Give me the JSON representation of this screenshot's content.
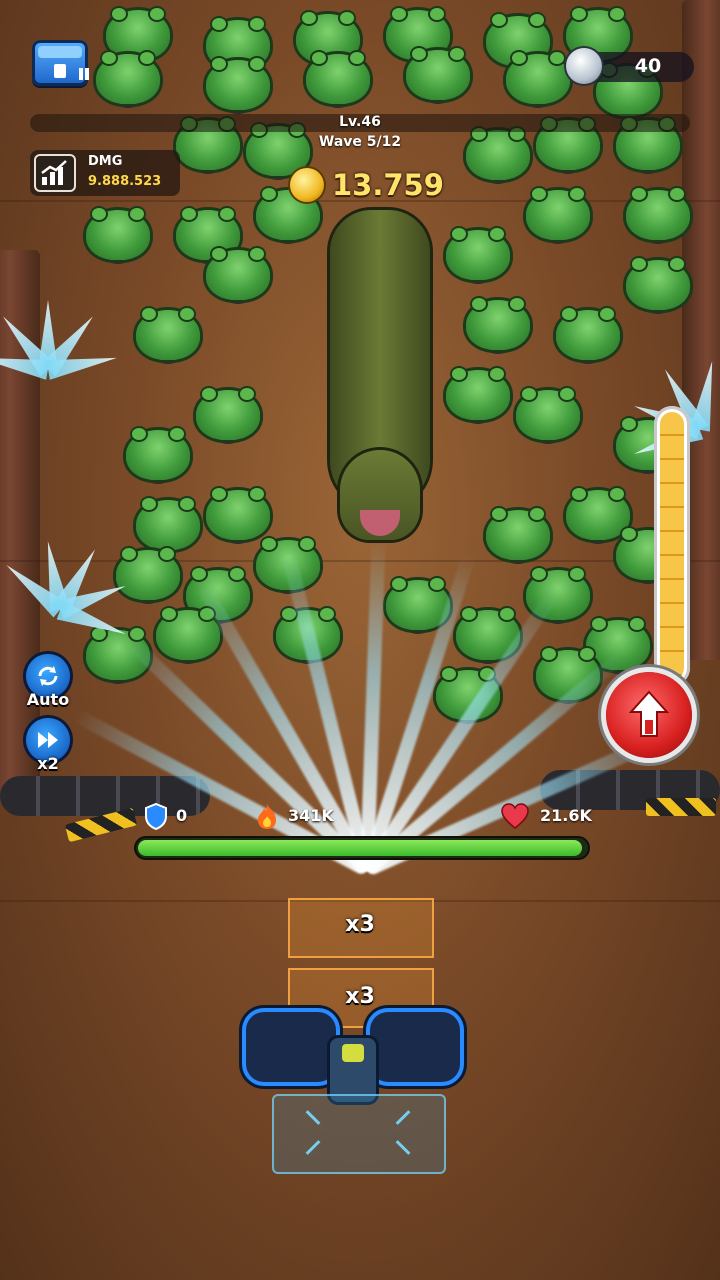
{
  "hud": {
    "gems": "40",
    "level": "Lv.46",
    "wave": "Wave 5/12",
    "dmg_label": "DMG",
    "dmg_value": "9.888.523",
    "coins": "13.759"
  },
  "side_buttons": {
    "auto_label": "Auto",
    "speed_label": "x2"
  },
  "base_stats": {
    "shield": "0",
    "fire": "341K",
    "hp": "21.6K",
    "hp_fraction": 0.99
  },
  "power_meter_fraction": 1.0,
  "turret": {
    "multiplier_top": "x3",
    "multiplier_bottom": "x3"
  },
  "colors": {
    "coin_text": "#ffe36a",
    "dmg_value": "#ffd84a",
    "hp_fill": "#3cba2a",
    "rocket_button": "#d82020",
    "meter_fill": "#f7c648"
  },
  "icons": [
    "chest-icon",
    "pause-icon",
    "gem-icon",
    "chart-icon",
    "coin-icon",
    "auto-cycle-icon",
    "fast-forward-icon",
    "shield-icon",
    "fire-icon",
    "heart-icon",
    "rocket-icon"
  ]
}
